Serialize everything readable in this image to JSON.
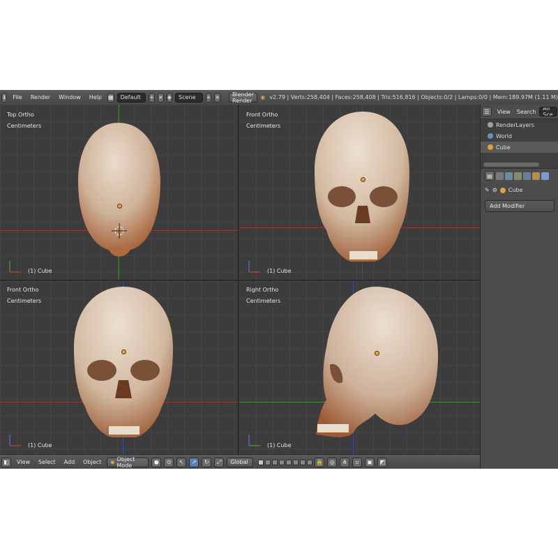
{
  "topbar": {
    "menus": [
      "File",
      "Render",
      "Window",
      "Help"
    ],
    "screen_layout": "Default",
    "scene": "Scene",
    "render_engine": "Blender Render",
    "stats": "v2.79 | Verts:258,404 | Faces:258,408 | Tris:516,816 | Objects:0/2 | Lamps:0/0 | Mem:189.97M (1.11 M)"
  },
  "viewports": [
    {
      "name": "Top Ortho",
      "units": "Centimeters",
      "object": "(1) Cube"
    },
    {
      "name": "Front Ortho",
      "units": "Centimeters",
      "object": "(1) Cube"
    },
    {
      "name": "Front Ortho",
      "units": "Centimeters",
      "object": "(1) Cube"
    },
    {
      "name": "Right Ortho",
      "units": "Centimeters",
      "object": "(1) Cube"
    }
  ],
  "outliner": {
    "view": "View",
    "search": "Search",
    "filter": "All Sce",
    "items": [
      "RenderLayers",
      "World",
      "Cube"
    ]
  },
  "properties": {
    "object": "Cube",
    "add_modifier": "Add Modifier"
  },
  "bottombar": {
    "menus": [
      "View",
      "Select",
      "Add",
      "Object"
    ],
    "mode": "Object Mode",
    "orientation": "Global"
  },
  "colors": {
    "bone": "#d8c3ad",
    "bone_shadow": "#b06a3e",
    "viewport_bg": "#3c3c3c",
    "x_axis": "#8c3a3a",
    "y_axis": "#4c8a3c",
    "z_axis": "#3a4f9a"
  }
}
